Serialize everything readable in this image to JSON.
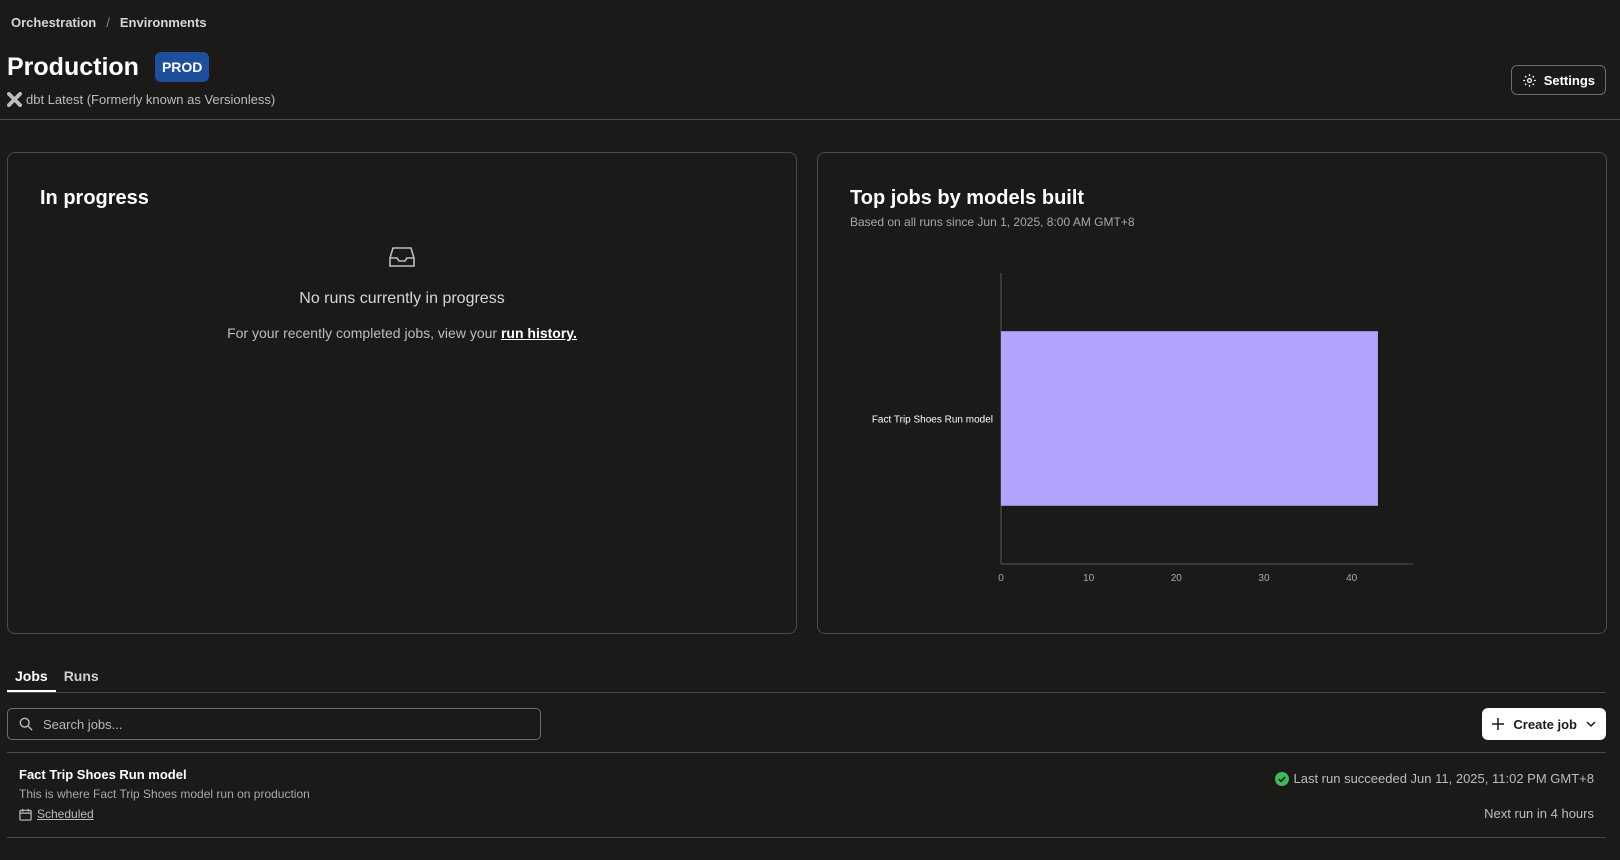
{
  "breadcrumb": {
    "items": [
      "Orchestration",
      "Environments"
    ],
    "separator": "/"
  },
  "header": {
    "title": "Production",
    "badge": "PROD",
    "version": "dbt Latest (Formerly known as Versionless)",
    "settings_label": "Settings"
  },
  "in_progress": {
    "title": "In progress",
    "empty_title": "No runs currently in progress",
    "empty_text": "For your recently completed jobs, view your",
    "link": "run history."
  },
  "top_jobs": {
    "title": "Top jobs by models built",
    "subtitle": "Based on all runs since Jun 1, 2025, 8:00 AM GMT+8"
  },
  "chart_data": {
    "type": "bar",
    "orientation": "horizontal",
    "categories": [
      "Fact Trip Shoes Run model"
    ],
    "values": [
      43
    ],
    "xlim": [
      0,
      47
    ],
    "xticks": [
      0,
      10,
      20,
      30,
      40
    ],
    "bar_color": "#b0a4ff",
    "grid": false
  },
  "tabs": [
    {
      "label": "Jobs",
      "active": true
    },
    {
      "label": "Runs",
      "active": false
    }
  ],
  "search": {
    "placeholder": "Search jobs..."
  },
  "create_job_label": "Create job",
  "jobs": [
    {
      "name": "Fact Trip Shoes Run model",
      "description": "This is where Fact Trip Shoes model run on production",
      "schedule": "Scheduled",
      "last_run": "Last run succeeded Jun 11, 2025, 11:02 PM GMT+8",
      "next_run": "Next run in 4 hours"
    }
  ],
  "colors": {
    "background": "#1b1a19",
    "badge": "#1d4f9c",
    "success": "#3dbb5c",
    "bar": "#b0a4ff"
  }
}
